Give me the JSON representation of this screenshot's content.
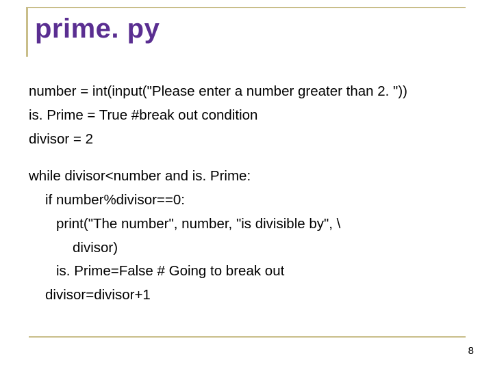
{
  "title": "prime. py",
  "code": {
    "l1": "number = int(input(\"Please enter a number greater than 2. \"))",
    "l2": "is. Prime = True #break out condition",
    "l3": "divisor = 2",
    "l4": "while divisor<number and is. Prime:",
    "l5": "if number%divisor==0:",
    "l6": "print(\"The number\", number, \"is divisible by\", \\",
    "l7": "divisor)",
    "l8": "is. Prime=False   # Going to break out",
    "l9": "divisor=divisor+1"
  },
  "page_number": "8"
}
